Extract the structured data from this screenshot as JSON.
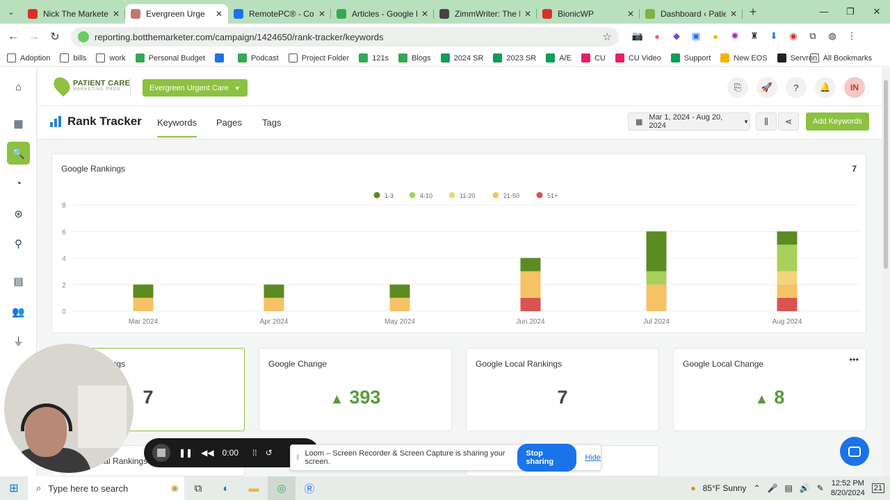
{
  "browser": {
    "tabs": [
      {
        "title": "Nick The Marketer",
        "icon": "record-icon",
        "color": "#d93025",
        "active": false
      },
      {
        "title": "Evergreen Urge",
        "icon": "page-icon",
        "color": "#c07a6b",
        "active": true
      },
      {
        "title": "RemotePC® - Comp",
        "icon": "r-logo-icon",
        "color": "#1a73e8",
        "active": false
      },
      {
        "title": "Articles - Google D",
        "icon": "drive-icon",
        "color": "#34a853",
        "active": false
      },
      {
        "title": "ZimmWriter: The Be",
        "icon": "z-logo-icon",
        "color": "#444444",
        "active": false
      },
      {
        "title": "BionicWP",
        "icon": "bionic-icon",
        "color": "#d93025",
        "active": false
      },
      {
        "title": "Dashboard ‹ Patien",
        "icon": "dashboard-icon",
        "color": "#7cb342",
        "active": false
      }
    ],
    "url": "reporting.botthemarketer.com/campaign/1424650/rank-tracker/keywords",
    "bookmarks": [
      {
        "label": "Adoption",
        "icon": "folder-icon",
        "color": "#555"
      },
      {
        "label": "bills",
        "icon": "folder-icon",
        "color": "#555"
      },
      {
        "label": "work",
        "icon": "folder-icon",
        "color": "#555"
      },
      {
        "label": "Personal Budget",
        "icon": "drive-icon",
        "color": "#34a853"
      },
      {
        "label": "",
        "icon": "chat-bubble-icon",
        "color": "#1a73e8"
      },
      {
        "label": "Podcast",
        "icon": "drive-icon",
        "color": "#34a853"
      },
      {
        "label": "Project Folder",
        "icon": "folder-icon",
        "color": "#555"
      },
      {
        "label": "121s",
        "icon": "drive-icon",
        "color": "#34a853"
      },
      {
        "label": "Blogs",
        "icon": "drive-icon",
        "color": "#34a853"
      },
      {
        "label": "2024 SR",
        "icon": "sheets-icon",
        "color": "#0f9d58"
      },
      {
        "label": "2023 SR",
        "icon": "sheets-icon",
        "color": "#0f9d58"
      },
      {
        "label": "A/E",
        "icon": "sheets-icon",
        "color": "#0f9d58"
      },
      {
        "label": "CU",
        "icon": "cu-icon",
        "color": "#e91e63"
      },
      {
        "label": "CU Video",
        "icon": "cu-icon",
        "color": "#e91e63"
      },
      {
        "label": "Support",
        "icon": "support-icon",
        "color": "#0f9d58"
      },
      {
        "label": "New EOS",
        "icon": "eos-icon",
        "color": "#f4b400"
      },
      {
        "label": "Servron",
        "icon": "servron-icon",
        "color": "#222"
      }
    ],
    "all_bookmarks": "All Bookmarks"
  },
  "app": {
    "campaign": "Evergreen Urgent Care",
    "logo_line1": "PATIENT CARE",
    "logo_line2": "MARKETING PROS",
    "avatar": "IN",
    "title": "Rank Tracker",
    "tabs": [
      "Keywords",
      "Pages",
      "Tags"
    ],
    "active_tab": "Keywords",
    "date_range": "Mar 1, 2024 - Aug 20, 2024",
    "add_keywords": "Add Keywords"
  },
  "chart_data": {
    "type": "bar",
    "title": "Google Rankings",
    "total": "7",
    "categories": [
      "Mar 2024",
      "Apr 2024",
      "May 2024",
      "Jun 2024",
      "Jul 2024",
      "Aug 2024"
    ],
    "series": [
      {
        "name": "1-3",
        "color": "#5b8c21",
        "values": [
          1,
          1,
          1,
          1,
          3,
          1
        ]
      },
      {
        "name": "4-10",
        "color": "#a8d05a",
        "values": [
          0,
          0,
          0,
          0,
          1,
          2
        ]
      },
      {
        "name": "11-20",
        "color": "#f2d57a",
        "values": [
          0,
          0,
          0,
          0,
          0,
          1
        ]
      },
      {
        "name": "21-50",
        "color": "#f5c266",
        "values": [
          1,
          1,
          1,
          2,
          2,
          1
        ]
      },
      {
        "name": "51+",
        "color": "#d9534f",
        "values": [
          0,
          0,
          0,
          1,
          0,
          1
        ]
      }
    ],
    "yticks": [
      "0",
      "2",
      "4",
      "6",
      "8"
    ],
    "ylim": [
      0,
      8
    ],
    "legend": "top-center",
    "grid": true
  },
  "stats": [
    {
      "label": "Google Rankings",
      "value": "7",
      "trend": "none"
    },
    {
      "label": "Google Change",
      "value": "393",
      "trend": "up"
    },
    {
      "label": "Google Local Rankings",
      "value": "7",
      "trend": "none"
    },
    {
      "label": "Google Local Change",
      "value": "8",
      "trend": "up"
    }
  ],
  "bottom_card_label": "Google Local Rankings",
  "loom": {
    "time": "0:00",
    "message": "Loom – Screen Recorder & Screen Capture is sharing your screen.",
    "stop": "Stop sharing",
    "hide": "Hide"
  },
  "taskbar": {
    "search_placeholder": "Type here to search",
    "weather": "85°F  Sunny",
    "time": "12:52 PM",
    "date": "8/20/2024",
    "notification_count": "21"
  }
}
